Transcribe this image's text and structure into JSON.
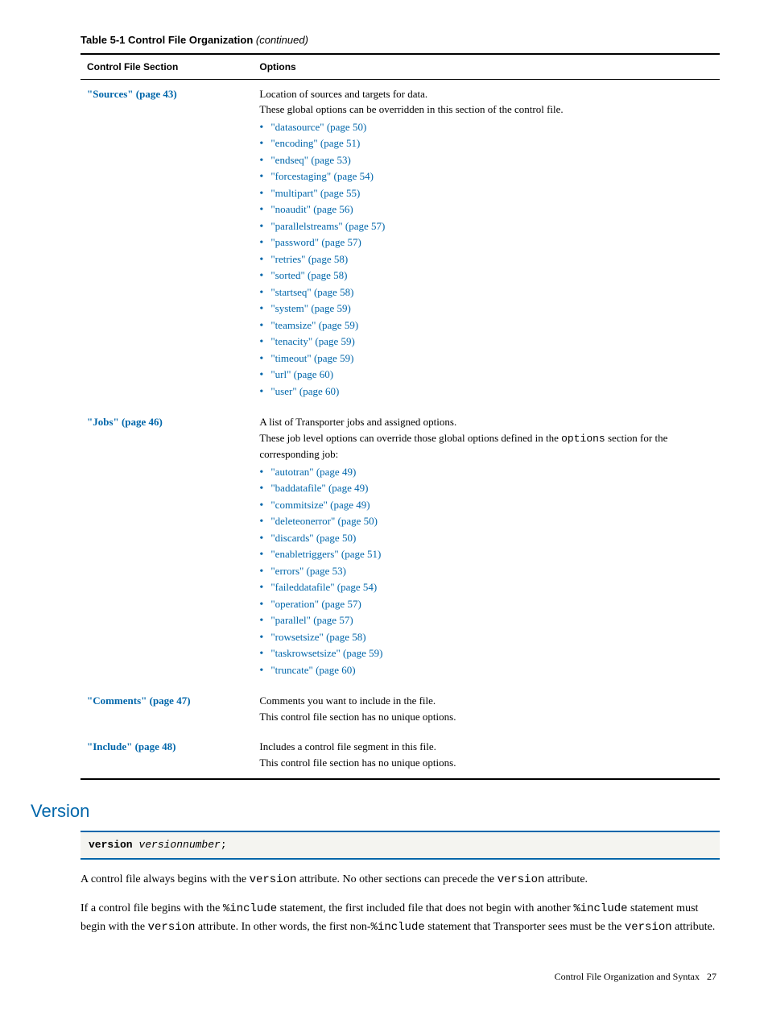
{
  "table": {
    "caption_prefix": "Table 5-1 Control File Organization",
    "caption_suffix": " (continued)",
    "headers": {
      "col1": "Control File Section",
      "col2": "Options"
    },
    "rows": [
      {
        "section": "\"Sources\" (page 43)",
        "intro_line1": "Location of sources and targets for data.",
        "intro_line2": "These global options can be overridden in this section of the control file.",
        "opts": [
          "\"datasource\" (page 50)",
          "\"encoding\" (page 51)",
          "\"endseq\" (page 53)",
          "\"forcestaging\" (page 54)",
          "\"multipart\" (page 55)",
          "\"noaudit\" (page 56)",
          "\"parallelstreams\" (page 57)",
          "\"password\" (page 57)",
          "\"retries\" (page 58)",
          "\"sorted\" (page 58)",
          "\"startseq\" (page 58)",
          "\"system\" (page 59)",
          "\"teamsize\" (page 59)",
          "\"tenacity\" (page 59)",
          "\"timeout\" (page 59)",
          "\"url\" (page 60)",
          "\"user\" (page 60)"
        ]
      },
      {
        "section": "\"Jobs\" (page 46)",
        "intro_line1": "A list of Transporter jobs and assigned options.",
        "intro_line2_pre": "These job level options can override those global options defined in the ",
        "intro_line2_mono": "options",
        "intro_line2_post": " section for the corresponding job:",
        "opts": [
          "\"autotran\" (page 49)",
          "\"baddatafile\" (page 49)",
          "\"commitsize\" (page 49)",
          "\"deleteonerror\" (page 50)",
          "\"discards\" (page 50)",
          "\"enabletriggers\" (page 51)",
          "\"errors\" (page 53)",
          "\"faileddatafile\" (page 54)",
          "\"operation\" (page 57)",
          "\"parallel\" (page 57)",
          "\"rowsetsize\" (page 58)",
          "\"taskrowsetsize\" (page 59)",
          "\"truncate\" (page 60)"
        ]
      },
      {
        "section": "\"Comments\" (page 47)",
        "intro_line1": "Comments you want to include in the file.",
        "intro_line2": "This control file section has no unique options."
      },
      {
        "section": "\"Include\" (page 48)",
        "intro_line1": "Includes a control file segment in this file.",
        "intro_line2": "This control file section has no unique options."
      }
    ]
  },
  "version_section": {
    "heading": "Version",
    "code_bold": "version",
    "code_ital": " versionnumber",
    "code_end": ";",
    "para1_a": "A control file always begins with the ",
    "para1_m1": "version",
    "para1_b": " attribute. No other sections can precede the ",
    "para1_m2": "version",
    "para1_c": " attribute.",
    "para2_a": "If a control file begins with the ",
    "para2_m1": "%include",
    "para2_b": " statement, the first included file that does not begin with another ",
    "para2_m2": "%include",
    "para2_c": " statement must begin with the ",
    "para2_m3": "version",
    "para2_d": " attribute. In other words, the first non-",
    "para2_m4": "%include",
    "para2_e": " statement that Transporter sees must be the ",
    "para2_m5": "version",
    "para2_f": " attribute."
  },
  "footer": {
    "text": "Control File Organization and Syntax",
    "page": "27"
  }
}
